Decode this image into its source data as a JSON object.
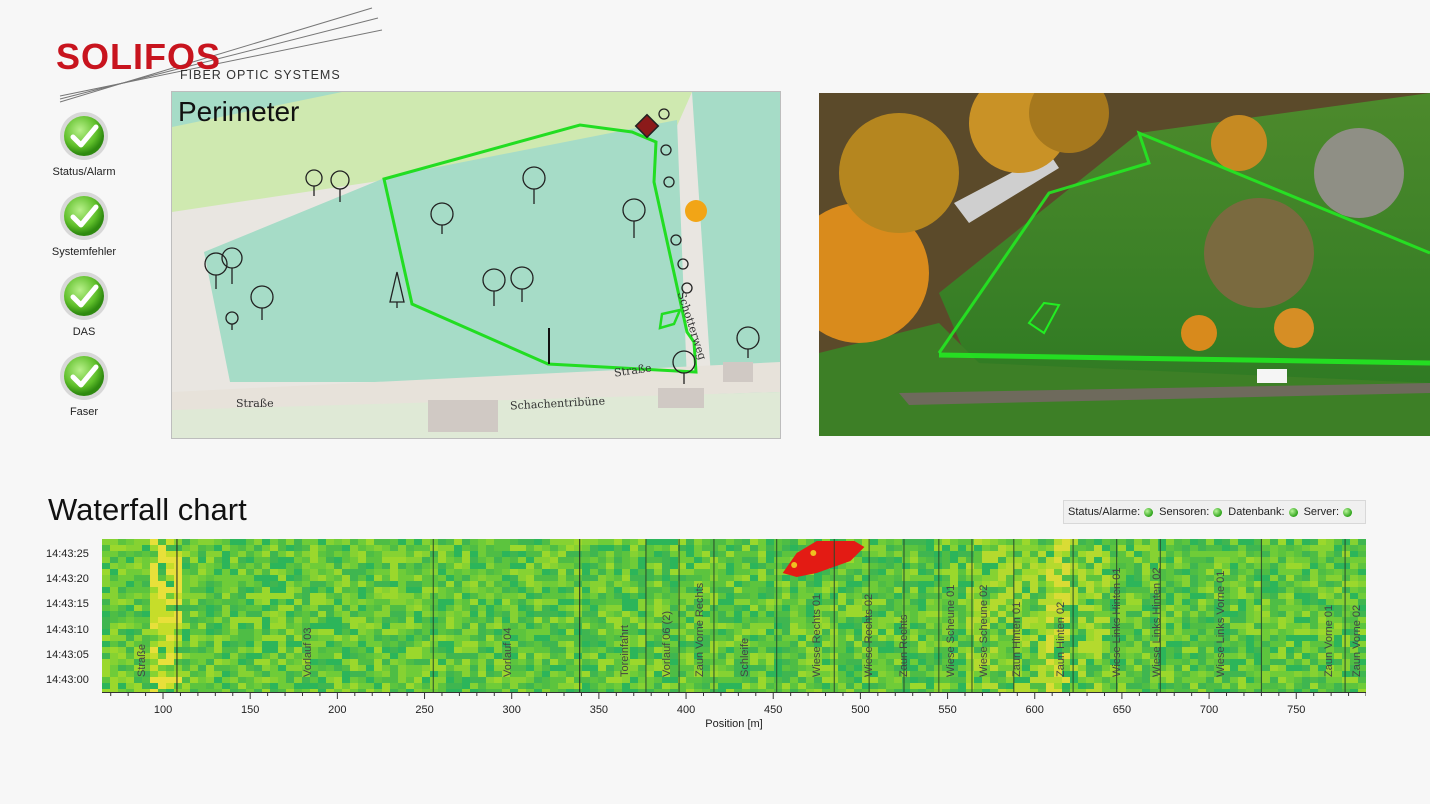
{
  "logo": {
    "brand": "SOLIFOS",
    "tagline": "FIBER OPTIC SYSTEMS"
  },
  "status_panel": [
    {
      "label": "Status/Alarm",
      "icon": "checkmark-icon",
      "state": "ok"
    },
    {
      "label": "Systemfehler",
      "icon": "checkmark-icon",
      "state": "ok"
    },
    {
      "label": "DAS",
      "icon": "checkmark-icon",
      "state": "ok"
    },
    {
      "label": "Faser",
      "icon": "checkmark-icon",
      "state": "ok"
    }
  ],
  "map": {
    "title": "Perimeter",
    "labels": {
      "road_left": "Straße",
      "road_right": "Straße",
      "building": "Schachentribüne",
      "path": "Schotterweg"
    },
    "colors": {
      "perimeter": "#22dd22",
      "alarm_marker": "#f2a516",
      "sensor_marker": "#8b1a1a",
      "field": "#a6dcc7",
      "meadow": "#cfe9b0"
    }
  },
  "waterfall": {
    "title": "Waterfall chart",
    "status_bar": [
      {
        "label": "Status/Alarme:",
        "state": "ok"
      },
      {
        "label": "Sensoren:",
        "state": "ok"
      },
      {
        "label": "Datenbank:",
        "state": "ok"
      },
      {
        "label": "Server:",
        "state": "ok"
      }
    ],
    "x_axis_label": "Position [m]"
  },
  "chart_data": {
    "type": "heatmap",
    "title": "Waterfall chart",
    "xlabel": "Position [m]",
    "ylabel": "",
    "xlim": [
      65,
      790
    ],
    "x_ticks": [
      100,
      150,
      200,
      250,
      300,
      350,
      400,
      450,
      500,
      550,
      600,
      650,
      700,
      750
    ],
    "y_ticks": [
      "14:43:25",
      "14:43:20",
      "14:43:15",
      "14:43:10",
      "14:43:05",
      "14:43:00"
    ],
    "zones": [
      {
        "name": "Straße",
        "center": 88
      },
      {
        "name": "Vorlauf 03",
        "center": 183
      },
      {
        "name": "Vorlauf 04",
        "center": 298
      },
      {
        "name": "Toreinfahrt",
        "center": 365
      },
      {
        "name": "Vorlauf 06 (2)",
        "center": 389
      },
      {
        "name": "Zaun Vorne Rechts",
        "center": 408
      },
      {
        "name": "Schleife",
        "center": 434
      },
      {
        "name": "Wiese Rechts 01",
        "center": 475
      },
      {
        "name": "Wiese Rechts 02",
        "center": 505
      },
      {
        "name": "Zaun Rechts",
        "center": 525
      },
      {
        "name": "Wiese Scheune 01",
        "center": 552
      },
      {
        "name": "Wiese Scheune 02",
        "center": 571
      },
      {
        "name": "Zaun Hinten 01",
        "center": 590
      },
      {
        "name": "Zaun Hinten 02",
        "center": 615
      },
      {
        "name": "Wiese Links Hinten 01",
        "center": 647
      },
      {
        "name": "Wiese Links Hinten 02",
        "center": 670
      },
      {
        "name": "Wiese Links Vorne 01",
        "center": 707
      },
      {
        "name": "Zaun Vorne 01",
        "center": 769
      },
      {
        "name": "Zaun Vorne 02",
        "center": 785
      }
    ],
    "zone_boundaries": [
      108,
      255,
      339,
      377,
      396,
      416,
      452,
      485,
      505,
      525,
      545,
      564,
      588,
      622,
      647,
      672,
      730,
      778
    ],
    "hotspot": {
      "x_from": 452,
      "x_to": 500,
      "time_from": "14:43:20",
      "time_to": "14:43:25",
      "level": "alarm"
    },
    "colorscale": [
      "#f0f038",
      "#a6e01e",
      "#5cc43e",
      "#2cb55a",
      "#e31b14"
    ]
  }
}
